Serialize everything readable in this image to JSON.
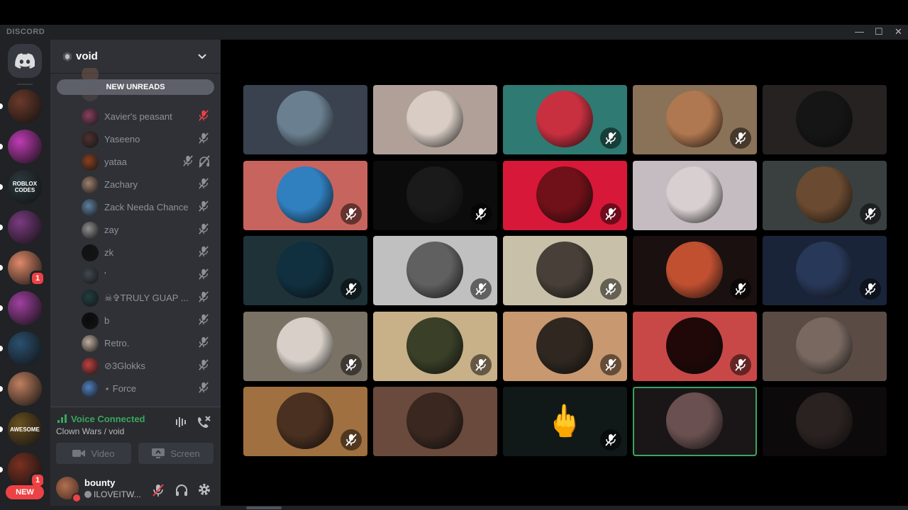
{
  "app": {
    "brand": "DISCORD"
  },
  "window": {
    "minimize": "—",
    "maximize": "☐",
    "close": "✕"
  },
  "server": {
    "name": "void"
  },
  "guilds": {
    "new_label": "NEW",
    "icons": [
      {
        "label": "",
        "color": "#6b3a2a",
        "badge": ""
      },
      {
        "label": "",
        "color": "#c03bb5",
        "badge": ""
      },
      {
        "label": "ROBLOX CODES",
        "color": "#2c3a40",
        "badge": ""
      },
      {
        "label": "",
        "color": "#7a3b80",
        "badge": ""
      },
      {
        "label": "",
        "color": "#e08a6a",
        "badge": "1"
      },
      {
        "label": "",
        "color": "#a040a0",
        "badge": ""
      },
      {
        "label": "",
        "color": "#2a5070",
        "badge": ""
      },
      {
        "label": "",
        "color": "#c08060",
        "badge": ""
      },
      {
        "label": "AWESOME",
        "color": "#6a5020",
        "badge": ""
      },
      {
        "label": "",
        "color": "#7a3020",
        "badge": "1"
      }
    ]
  },
  "channel": {
    "new_unreads": "NEW UNREADS",
    "members": [
      {
        "name": "Xavier's peasant",
        "color": "#8a4060",
        "state": "muted-red",
        "deafened": false
      },
      {
        "name": "Yaseeno",
        "color": "#503030",
        "state": "muted",
        "deafened": false
      },
      {
        "name": "yataa",
        "color": "#8a4020",
        "state": "muted",
        "deafened": true
      },
      {
        "name": "Zachary",
        "color": "#a08070",
        "state": "muted",
        "deafened": false
      },
      {
        "name": "Zack Needa Chance",
        "color": "#6080a0",
        "state": "muted",
        "deafened": false
      },
      {
        "name": "zay",
        "color": "#909090",
        "state": "muted",
        "deafened": false
      },
      {
        "name": "zk",
        "color": "#111111",
        "state": "muted",
        "deafened": false
      },
      {
        "name": "'",
        "color": "#404850",
        "state": "muted",
        "deafened": false
      },
      {
        "name": "☠✞TRULY GUAP ...",
        "color": "#204040",
        "state": "muted",
        "deafened": false
      },
      {
        "name": "b",
        "color": "#0a0a0a",
        "state": "muted",
        "deafened": false
      },
      {
        "name": "Retro.",
        "color": "#c0b0a0",
        "state": "muted",
        "deafened": false
      },
      {
        "name": "⊘3Glokks",
        "color": "#c04040",
        "state": "muted",
        "deafened": false
      },
      {
        "name": "⋆ Force",
        "color": "#5080c0",
        "state": "muted",
        "deafened": false
      }
    ]
  },
  "voice": {
    "status": "Voice Connected",
    "channel_path": "Clown Wars / void",
    "video_label": "Video",
    "screen_label": "Screen"
  },
  "user": {
    "name": "bounty",
    "status": "ILOVEITW..."
  },
  "grid": {
    "tiles": [
      {
        "bg": "#3a4250",
        "av": "#6a8090",
        "muted": false,
        "speaking": false
      },
      {
        "bg": "#b0a098",
        "av": "#d8ccc4",
        "muted": false,
        "speaking": false
      },
      {
        "bg": "#2f7a72",
        "av": "#c83040",
        "muted": true,
        "speaking": false
      },
      {
        "bg": "#8a7258",
        "av": "#b07850",
        "muted": true,
        "speaking": false
      },
      {
        "bg": "#272222",
        "av": "#151515",
        "muted": false,
        "speaking": false
      },
      {
        "bg": "#c8645e",
        "av": "#3080c0",
        "muted": true,
        "speaking": false
      },
      {
        "bg": "#0c0c0c",
        "av": "#1a1a1a",
        "muted": true,
        "speaking": false
      },
      {
        "bg": "#d81838",
        "av": "#701018",
        "muted": true,
        "speaking": false
      },
      {
        "bg": "#c4bcc0",
        "av": "#d8d0d0",
        "muted": false,
        "speaking": false
      },
      {
        "bg": "#3a4040",
        "av": "#6a4a30",
        "muted": true,
        "speaking": false
      },
      {
        "bg": "#1e3238",
        "av": "#103040",
        "muted": true,
        "speaking": false
      },
      {
        "bg": "#c0c0c0",
        "av": "#606060",
        "muted": true,
        "speaking": false
      },
      {
        "bg": "#c8c0a8",
        "av": "#484038",
        "muted": true,
        "speaking": false
      },
      {
        "bg": "#1a1010",
        "av": "#c05030",
        "muted": true,
        "speaking": false
      },
      {
        "bg": "#1a2438",
        "av": "#283858",
        "muted": true,
        "speaking": false
      },
      {
        "bg": "#7a7264",
        "av": "#d8d0c8",
        "muted": true,
        "speaking": false
      },
      {
        "bg": "#c8b088",
        "av": "#3a4028",
        "muted": true,
        "speaking": false
      },
      {
        "bg": "#c89870",
        "av": "#302820",
        "muted": true,
        "speaking": false
      },
      {
        "bg": "#c84848",
        "av": "#200808",
        "muted": true,
        "speaking": false
      },
      {
        "bg": "#5a4c44",
        "av": "#786860",
        "muted": false,
        "speaking": false
      },
      {
        "bg": "#a07040",
        "av": "#4a3020",
        "muted": true,
        "speaking": false
      },
      {
        "bg": "#6a4a3c",
        "av": "#3a2820",
        "muted": false,
        "speaking": false
      },
      {
        "bg": "#101818",
        "av": "#101818",
        "muted": true,
        "speaking": false,
        "emoji": "🖕"
      },
      {
        "bg": "#1a1618",
        "av": "#6a5050",
        "muted": false,
        "speaking": true
      },
      {
        "bg": "#0c0a0a",
        "av": "#2a2220",
        "muted": false,
        "speaking": false
      }
    ]
  }
}
